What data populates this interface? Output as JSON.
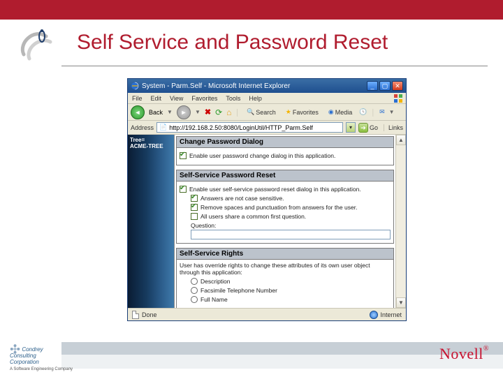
{
  "slide": {
    "title": "Self Service and Password Reset",
    "footer_left_line1": "Condrey",
    "footer_left_line2": "Consulting",
    "footer_left_line3": "Corporation",
    "footer_left_sub": "A Software Engineering Company",
    "footer_right": "Novell"
  },
  "window": {
    "title": "System - Parm.Self - Microsoft Internet Explorer",
    "menu": {
      "file": "File",
      "edit": "Edit",
      "view": "View",
      "favorites": "Favorites",
      "tools": "Tools",
      "help": "Help"
    },
    "toolbar": {
      "back": "Back",
      "search": "Search",
      "favorites": "Favorites",
      "media": "Media"
    },
    "address": {
      "label": "Address",
      "value": "http://192.168.2.50:8080/LoginUtil/HTTP_Parm.Self",
      "go": "Go",
      "links": "Links"
    },
    "sidebar": {
      "tree_label": "Tree=",
      "tree_value": "ACME-TREE"
    },
    "panels": {
      "p1": {
        "title": "Change Password Dialog",
        "opt1": "Enable user password change dialog in this application."
      },
      "p2": {
        "title": "Self-Service Password Reset",
        "opt1": "Enable user self-service password reset dialog in this application.",
        "opt2": "Answers are not case sensitive.",
        "opt3": "Remove spaces and punctuation from answers for the user.",
        "opt4": "All users share a common first question.",
        "question_label": "Question:"
      },
      "p3": {
        "title": "Self-Service Rights",
        "desc": "User has override rights to change these attributes of its own user object through this application:",
        "a1": "Description",
        "a2": "Facsimile Telephone Number",
        "a3": "Full Name"
      }
    },
    "status": {
      "left": "Done",
      "zone": "Internet"
    }
  }
}
